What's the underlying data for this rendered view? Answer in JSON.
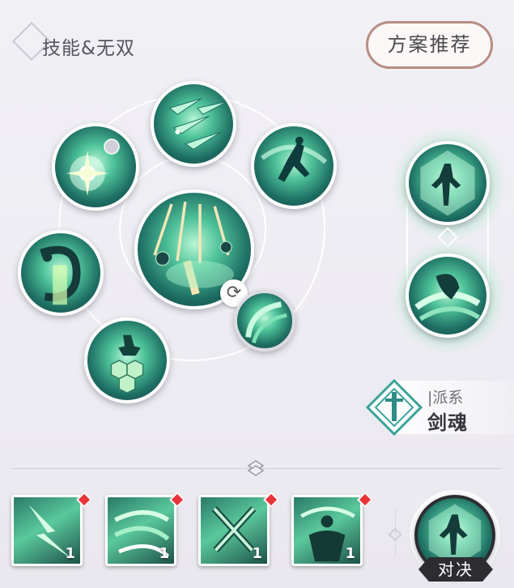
{
  "header": {
    "title": "技能&无双",
    "recommend_button": "方案推荐"
  },
  "skill_wheel": {
    "orbs": [
      {
        "name": "center-skill",
        "icon": "sword-pillars"
      },
      {
        "name": "top-skill",
        "icon": "arrows-spread"
      },
      {
        "name": "upper-left-skill",
        "icon": "starburst"
      },
      {
        "name": "upper-right-skill",
        "icon": "leaping-figure"
      },
      {
        "name": "left-skill",
        "icon": "dragon-spirit"
      },
      {
        "name": "lower-left-skill",
        "icon": "armored-warrior"
      },
      {
        "name": "lower-right-skill",
        "icon": "wave-swirl"
      }
    ]
  },
  "ultimates": [
    {
      "icon": "crystal-warrior"
    },
    {
      "icon": "whirlwind-dragon"
    }
  ],
  "faction": {
    "label": "|派系",
    "name": "剑魂",
    "color": "#3aa39a"
  },
  "hotbar": [
    {
      "icon": "lightning-slash",
      "count": "1"
    },
    {
      "icon": "crescent-waves",
      "count": "1"
    },
    {
      "icon": "crossed-swords",
      "count": "1"
    },
    {
      "icon": "muscle-figure",
      "count": "1"
    }
  ],
  "duel": {
    "label": "对决",
    "icon": "crystal-warrior"
  },
  "colors": {
    "accent_red": "#e8333a",
    "button_border": "#b88d84",
    "skill_green": "#4fc39a"
  }
}
